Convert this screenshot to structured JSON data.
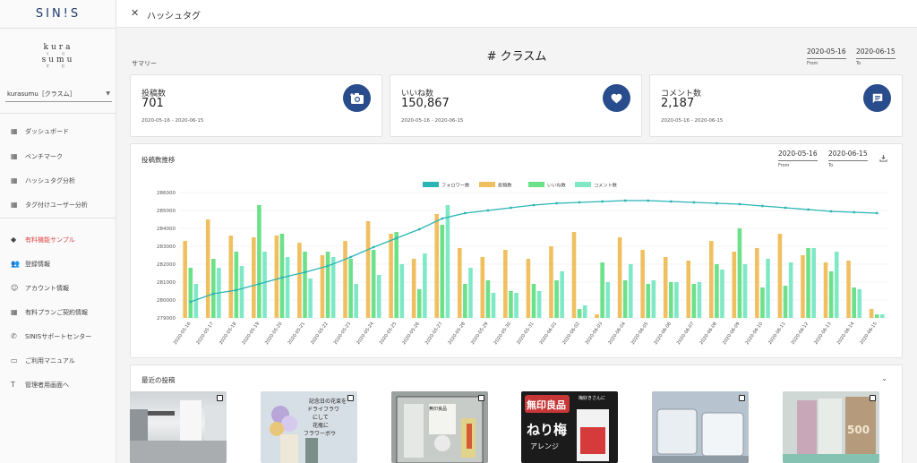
{
  "sidebar": {
    "logo": "SIN!S",
    "brand_line1": "kura",
    "brand_sub1": "く ら",
    "brand_line2": "sumu",
    "brand_sub2": "す む",
    "account": "kurasumu［クラスム］",
    "items": [
      {
        "label": "ダッシュボード",
        "icon": "grid-icon"
      },
      {
        "label": "ベンチマーク",
        "icon": "grid-icon"
      },
      {
        "label": "ハッシュタグ分析",
        "icon": "grid-icon"
      },
      {
        "label": "タグ付けユーザー分析",
        "icon": "grid-icon"
      },
      {
        "label": "有料機能サンプル",
        "icon": "tag-icon"
      },
      {
        "label": "登録情報",
        "icon": "people-icon"
      },
      {
        "label": "アカウント情報",
        "icon": "smiley-icon"
      },
      {
        "label": "有料プランご契約情報",
        "icon": "grid-icon"
      },
      {
        "label": "SINISサポートセンター",
        "icon": "phone-icon"
      },
      {
        "label": "ご利用マニュアル",
        "icon": "laptop-icon"
      },
      {
        "label": "管理者用画面へ",
        "icon": "text-icon"
      }
    ]
  },
  "topbar": {
    "close": "✕",
    "title": "ハッシュタグ"
  },
  "header": {
    "hashtag": "# クラスム",
    "summary_label": "サマリー",
    "date_from": "2020-05-16",
    "date_to": "2020-06-15",
    "from_label": "From",
    "to_label": "To"
  },
  "stats": [
    {
      "label": "投稿数",
      "value": "701",
      "range": "2020-05-16 - 2020-06-15",
      "icon": "camera-icon"
    },
    {
      "label": "いいね数",
      "value": "150,867",
      "range": "2020-05-16 - 2020-06-15",
      "icon": "heart-icon"
    },
    {
      "label": "コメント数",
      "value": "2,187",
      "range": "2020-05-16 - 2020-06-15",
      "icon": "comment-icon"
    }
  ],
  "chart_panel": {
    "title": "投稿数推移",
    "date_from": "2020-05-16",
    "date_to": "2020-06-15",
    "from_label": "From",
    "to_label": "To"
  },
  "chart_data": {
    "type": "bar",
    "ylim": [
      279000,
      286000
    ],
    "yticks": [
      279000,
      280000,
      281000,
      282000,
      283000,
      284000,
      285000,
      286000
    ],
    "categories": [
      "2020-05-16",
      "2020-05-17",
      "2020-05-18",
      "2020-05-19",
      "2020-05-20",
      "2020-05-21",
      "2020-05-22",
      "2020-05-23",
      "2020-05-24",
      "2020-05-25",
      "2020-05-26",
      "2020-05-27",
      "2020-05-28",
      "2020-05-29",
      "2020-05-30",
      "2020-05-31",
      "2020-06-01",
      "2020-06-02",
      "2020-06-03",
      "2020-06-04",
      "2020-06-05",
      "2020-06-06",
      "2020-06-07",
      "2020-06-08",
      "2020-06-09",
      "2020-06-10",
      "2020-06-11",
      "2020-06-12",
      "2020-06-13",
      "2020-06-14",
      "2020-06-15"
    ],
    "legend": [
      "フォロワー数",
      "投稿数",
      "いいね数",
      "コメント数"
    ],
    "series": [
      {
        "name": "フォロワー数",
        "type": "line",
        "color": "#2ab5b5",
        "values": [
          279900,
          280350,
          280550,
          280900,
          281250,
          281550,
          281900,
          282400,
          282950,
          283450,
          283950,
          284550,
          284850,
          285000,
          285150,
          285300,
          285400,
          285450,
          285500,
          285550,
          285550,
          285500,
          285450,
          285400,
          285350,
          285250,
          285150,
          285050,
          284950,
          284900,
          284850
        ]
      },
      {
        "name": "投稿数",
        "type": "bar",
        "color": "#f0c060",
        "values": [
          283300,
          284500,
          283600,
          283500,
          283600,
          283200,
          282500,
          283300,
          284400,
          283700,
          282300,
          284800,
          282900,
          282400,
          282800,
          282300,
          283000,
          283800,
          279200,
          283500,
          282800,
          282400,
          282200,
          283300,
          282700,
          282900,
          283700,
          282500,
          282100,
          282200,
          279500
        ]
      },
      {
        "name": "いいね数",
        "type": "bar",
        "color": "#6de08a",
        "values": [
          281800,
          282300,
          282700,
          285300,
          283700,
          282700,
          282700,
          282300,
          282800,
          283800,
          280600,
          284200,
          280900,
          281100,
          280500,
          280900,
          281100,
          279500,
          282100,
          281100,
          280900,
          281000,
          280900,
          282000,
          284000,
          280700,
          280800,
          282900,
          281600,
          280700,
          279200
        ]
      },
      {
        "name": "コメント数",
        "type": "bar",
        "color": "#7fe8c6",
        "values": [
          280900,
          281800,
          281900,
          282700,
          282400,
          281200,
          282400,
          280900,
          281400,
          282000,
          282600,
          285300,
          281800,
          280400,
          280400,
          280500,
          281600,
          279700,
          281000,
          282000,
          281100,
          281000,
          281000,
          281700,
          282000,
          282300,
          282100,
          282900,
          282700,
          280600,
          279200
        ]
      }
    ]
  },
  "recent": {
    "title": "最近の投稿",
    "thumb2_lines": [
      "記念日の花束を",
      "ドライフラワ",
      "にして",
      "花瓶に",
      "フラワーボウ"
    ],
    "thumb3_text": "無印良品",
    "thumb4_line1": "無印良品",
    "thumb4_line2": "ねり梅",
    "thumb4_line3": "アレンジ",
    "thumb4_side": "梅好きさんに",
    "thumb6_text": "500"
  }
}
